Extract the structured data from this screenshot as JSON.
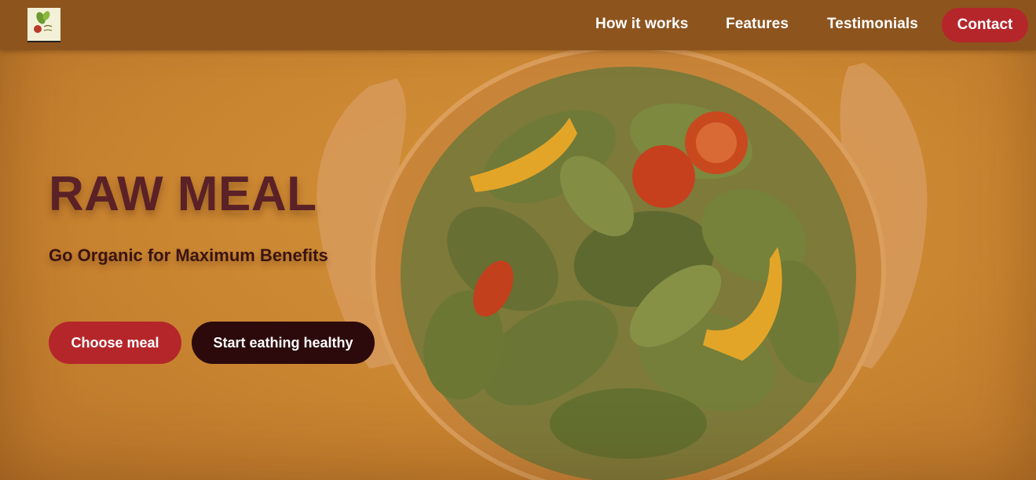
{
  "nav": {
    "logo_alt": "Raw Meal logo",
    "links": [
      "How it works",
      "Features",
      "Testimonials"
    ],
    "contact_label": "Contact"
  },
  "hero": {
    "title": "RAW MEAL",
    "subtitle": "Go Organic for Maximum Benefits",
    "primary_button": "Choose meal",
    "secondary_button": "Start eathing healthy"
  },
  "colors": {
    "overlay": "#c98430",
    "navbar": "#8d541e",
    "accent_red": "#b5262b",
    "dark_button": "#2c0a0b",
    "title": "#5a2127"
  }
}
